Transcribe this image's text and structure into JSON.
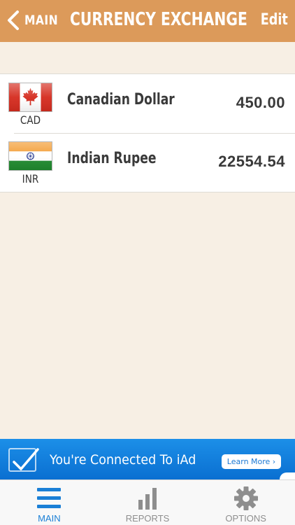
{
  "navbar": {
    "back_label": "MAIN",
    "title": "CURRENCY EXCHANGE",
    "edit_label": "Edit",
    "background": "#dc9a5a"
  },
  "currencies": [
    {
      "code": "CAD",
      "name": "Canadian Dollar",
      "amount": "450.00",
      "flag": "canada-flag-icon"
    },
    {
      "code": "INR",
      "name": "Indian Rupee",
      "amount": "22554.54",
      "flag": "india-flag-icon"
    }
  ],
  "ad": {
    "text": "You're Connected To iAd",
    "button_label": "Learn More ›",
    "background": "#0a6fd1"
  },
  "tabs": [
    {
      "label": "MAIN",
      "icon": "menu-icon",
      "active": true
    },
    {
      "label": "REPORTS",
      "icon": "bar-chart-icon",
      "active": false
    },
    {
      "label": "OPTIONS",
      "icon": "gear-icon",
      "active": false
    }
  ],
  "colors": {
    "accent": "#1a7fd6",
    "page_background": "#f7efe4"
  }
}
